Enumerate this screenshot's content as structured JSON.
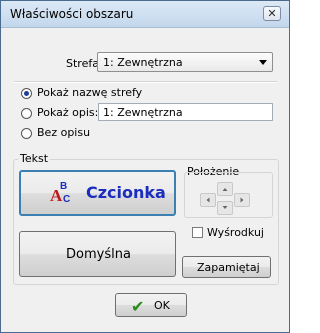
{
  "window": {
    "title": "Właściwości obszaru",
    "close_glyph": "✕"
  },
  "zone": {
    "label": "Strefa:",
    "selected": "1: Zewnętrzna"
  },
  "display_options": {
    "show_name_label": "Pokaż nazwę strefy",
    "show_description_label": "Pokaż opis:",
    "description_value": "1: Zewnętrzna",
    "no_description_label": "Bez opisu",
    "selected_option": "show_name"
  },
  "text_group": {
    "label": "Tekst",
    "font_button": "Czcionka",
    "default_button": "Domyślna"
  },
  "position_group": {
    "label": "Położenie",
    "center_checkbox": "Wyśrodkuj",
    "center_checked": false,
    "save_button": "Zapamiętaj"
  },
  "footer": {
    "ok_button": "OK"
  },
  "icons": {
    "font_icon": "font-abc-icon",
    "ok_icon": "checkmark-icon",
    "arrows": [
      "arrow-up-icon",
      "arrow-left-icon",
      "arrow-right-icon",
      "arrow-down-icon"
    ]
  },
  "colors": {
    "title_bar": "#c9dcf0",
    "font_label": "#1a2dbf",
    "ok_check": "#2a8a1a",
    "font_button_border": "#3c7fb1"
  }
}
